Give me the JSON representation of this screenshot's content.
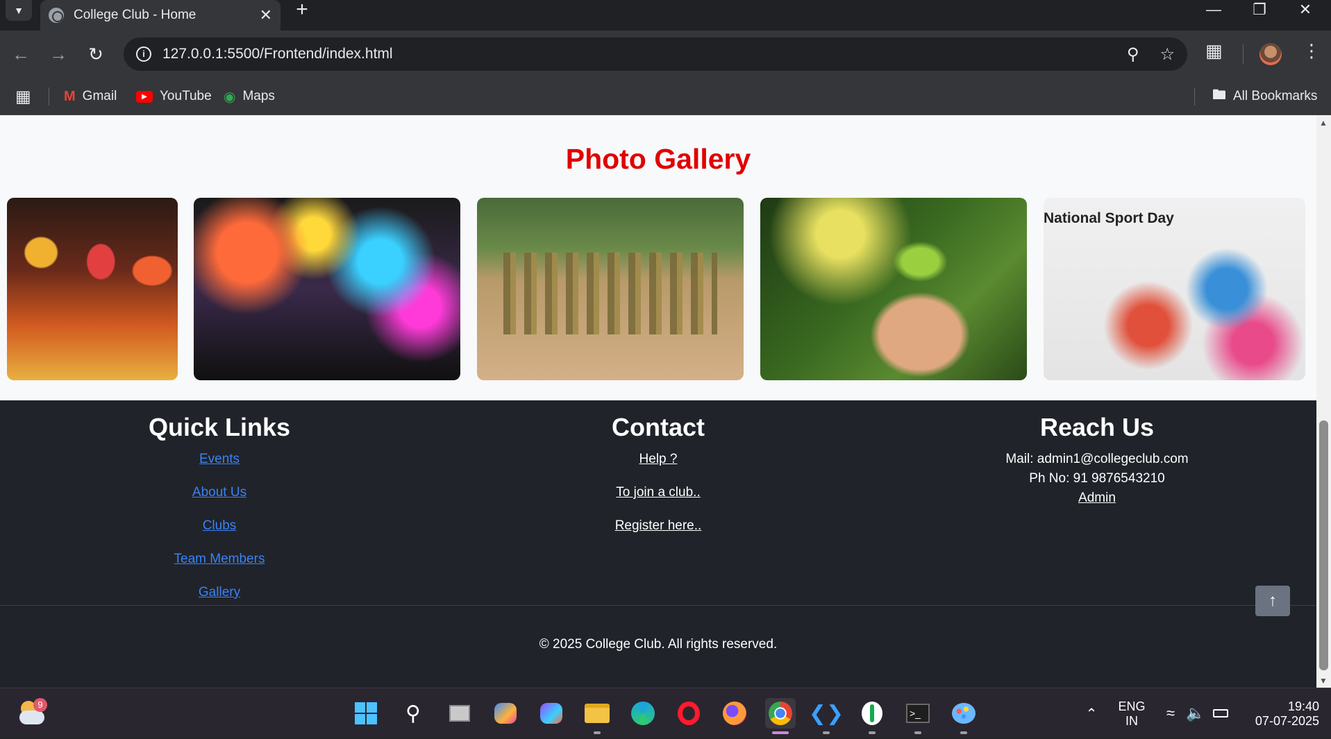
{
  "browser": {
    "tab_title": "College Club - Home",
    "url": "127.0.0.1:5500/Frontend/index.html",
    "bookmarks": [
      {
        "label": "Gmail",
        "icon": "gmail-icon"
      },
      {
        "label": "YouTube",
        "icon": "youtube-icon"
      },
      {
        "label": "Maps",
        "icon": "maps-icon"
      }
    ],
    "all_bookmarks_label": "All Bookmarks"
  },
  "gallery": {
    "title": "Photo Gallery",
    "title_color": "#e00000",
    "photos": [
      {
        "name": "classical-dance-photo"
      },
      {
        "name": "music-band-photo"
      },
      {
        "name": "ncc-parade-photo"
      },
      {
        "name": "plant-in-hands-photo"
      },
      {
        "name": "national-sport-day-photo",
        "caption": "National Sport Day"
      }
    ]
  },
  "footer": {
    "quick_links": {
      "heading": "Quick Links",
      "links": [
        "Events",
        "About Us",
        "Clubs",
        "Team Members",
        "Gallery"
      ]
    },
    "contact": {
      "heading": "Contact",
      "links": [
        "Help ?",
        "To join a club..",
        "Register here.."
      ]
    },
    "reach_us": {
      "heading": "Reach Us",
      "mail": "Mail: admin1@collegeclub.com",
      "phone": "Ph No: 91 9876543210",
      "admin_link": "Admin"
    },
    "copyright": "© 2025 College Club. All rights reserved.",
    "link_color": "#3b82f6",
    "background": "#20232a"
  },
  "taskbar": {
    "weather_badge": "9",
    "language_line1": "ENG",
    "language_line2": "IN",
    "time": "19:40",
    "date": "07-07-2025"
  }
}
